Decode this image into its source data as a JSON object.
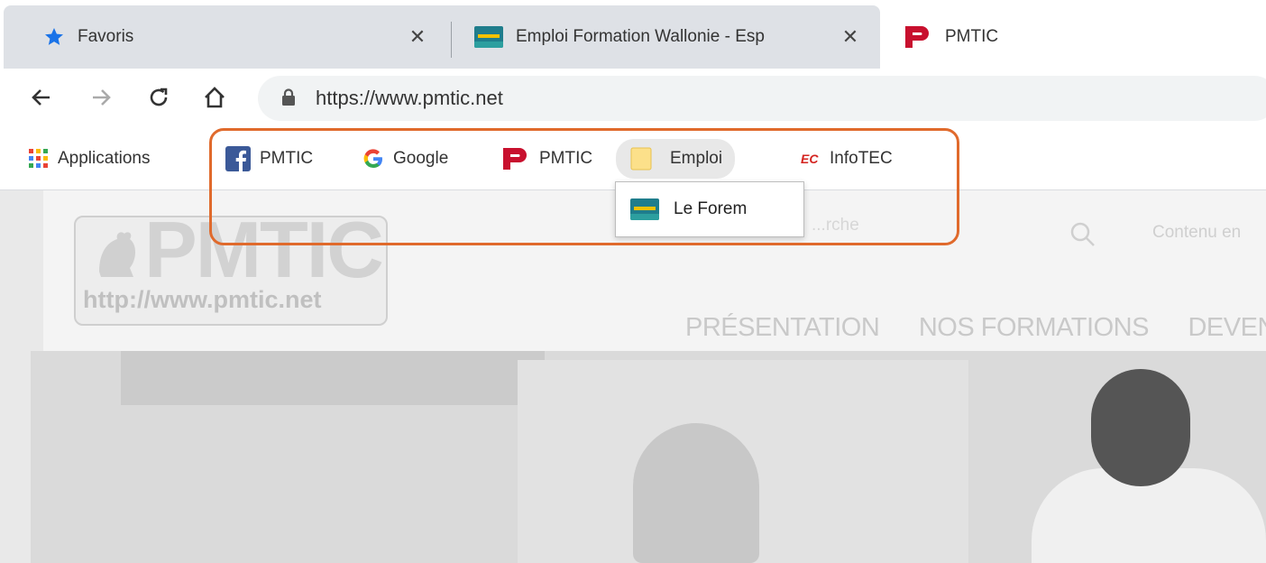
{
  "tabs": [
    {
      "label": "Favoris",
      "icon": "star-icon",
      "active": false
    },
    {
      "label": "Emploi Formation Wallonie - Esp",
      "icon": "le-forem-favicon",
      "active": false
    },
    {
      "label": "PMTIC",
      "icon": "pmtic-favicon",
      "active": true
    }
  ],
  "toolbar": {
    "url": "https://www.pmtic.net"
  },
  "bookmarks": {
    "apps_label": "Applications",
    "items": [
      {
        "label": "PMTIC",
        "icon": "facebook-icon"
      },
      {
        "label": "Google",
        "icon": "google-icon"
      },
      {
        "label": "PMTIC",
        "icon": "pmtic-favicon"
      },
      {
        "label": "Emploi",
        "icon": "folder-icon"
      },
      {
        "label": "InfoTEC",
        "icon": "infotec-icon"
      }
    ],
    "folder_menu": [
      {
        "label": "Le Forem",
        "icon": "le-forem-favicon"
      }
    ]
  },
  "page": {
    "logo_text": "PMTIC",
    "logo_url": "http://www.pmtic.net",
    "search_placeholder": "...rche",
    "contenu": "Contenu en",
    "nav": [
      "PRÉSENTATION",
      "NOS FORMATIONS",
      "DEVEN"
    ]
  },
  "colors": {
    "highlight": "#e06a2c",
    "pmtic_red": "#c8102e",
    "facebook_blue": "#3b5998",
    "star_blue": "#1a73e8"
  }
}
